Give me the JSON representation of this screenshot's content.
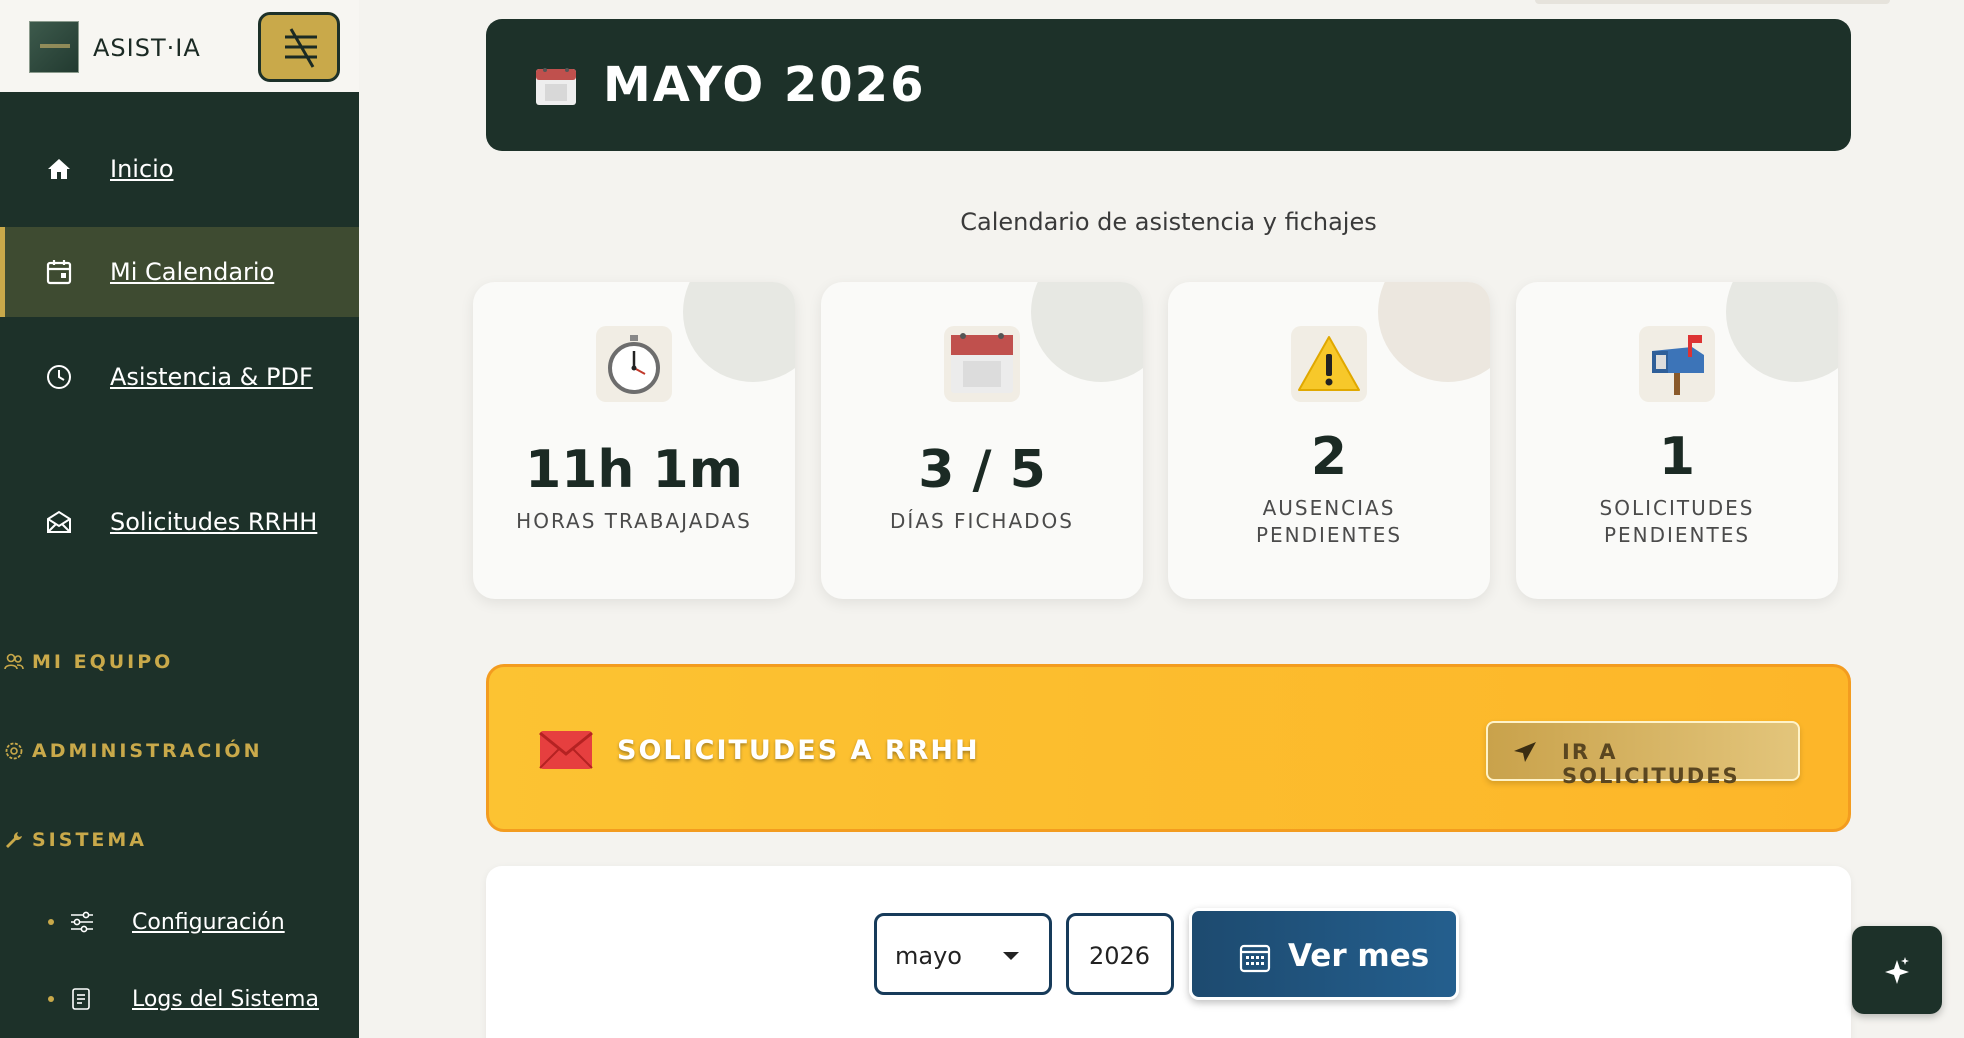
{
  "brand": {
    "name": "ASIST·IA"
  },
  "sidebar": {
    "items": [
      {
        "label": "Inicio",
        "icon": "home-icon"
      },
      {
        "label": "Mi Calendario",
        "icon": "calendar-icon",
        "active": true
      },
      {
        "label": "Asistencia & PDF",
        "icon": "clock-icon"
      },
      {
        "label": "Solicitudes RRHH",
        "icon": "envelope-icon"
      }
    ],
    "sections": [
      {
        "label": "MI EQUIPO",
        "icon": "team-icon"
      },
      {
        "label": "ADMINISTRACIÓN",
        "icon": "gear-icon"
      },
      {
        "label": "SISTEMA",
        "icon": "wrench-icon"
      }
    ],
    "system_items": [
      {
        "label": "Configuración",
        "icon": "sliders-icon"
      },
      {
        "label": "Logs del Sistema",
        "icon": "log-icon"
      }
    ]
  },
  "header": {
    "title": "MAYO 2026",
    "icon": "calendar-icon"
  },
  "subtitle": "Calendario de asistencia y fichajes",
  "stats": [
    {
      "value": "11h 1m",
      "label": "HORAS TRABAJADAS",
      "icon": "stopwatch-icon"
    },
    {
      "value": "3 / 5",
      "label": "DÍAS FICHADOS",
      "icon": "calendar-icon"
    },
    {
      "value": "2",
      "label": "AUSENCIAS PENDIENTES",
      "icon": "warning-icon"
    },
    {
      "value": "1",
      "label": "SOLICITUDES PENDIENTES",
      "icon": "mailbox-icon"
    }
  ],
  "rrhh": {
    "title": "SOLICITUDES A RRHH",
    "button": "IR A SOLICITUDES",
    "icon": "envelope-icon"
  },
  "filter": {
    "month": "mayo",
    "year": "2026",
    "button": "Ver mes"
  },
  "colors": {
    "primary": "#1d3129",
    "accent": "#c9a94a",
    "banner": "#fdb629",
    "button_blue": "#1d4a6f"
  }
}
